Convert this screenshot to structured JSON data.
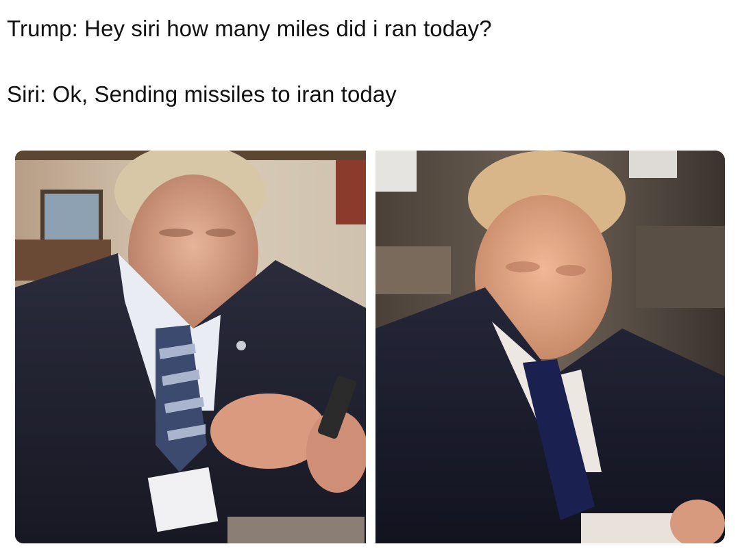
{
  "caption": {
    "line1": "Trump: Hey siri how many miles did i ran today?",
    "line2": "Siri: Ok, Sending missiles to iran today"
  },
  "photos": [
    {
      "description": "man in dark suit and striped tie looking down at phone held in hands, indoor room background"
    },
    {
      "description": "man in dark suit with blurred face looking down, seated at desk, dark office background"
    }
  ]
}
